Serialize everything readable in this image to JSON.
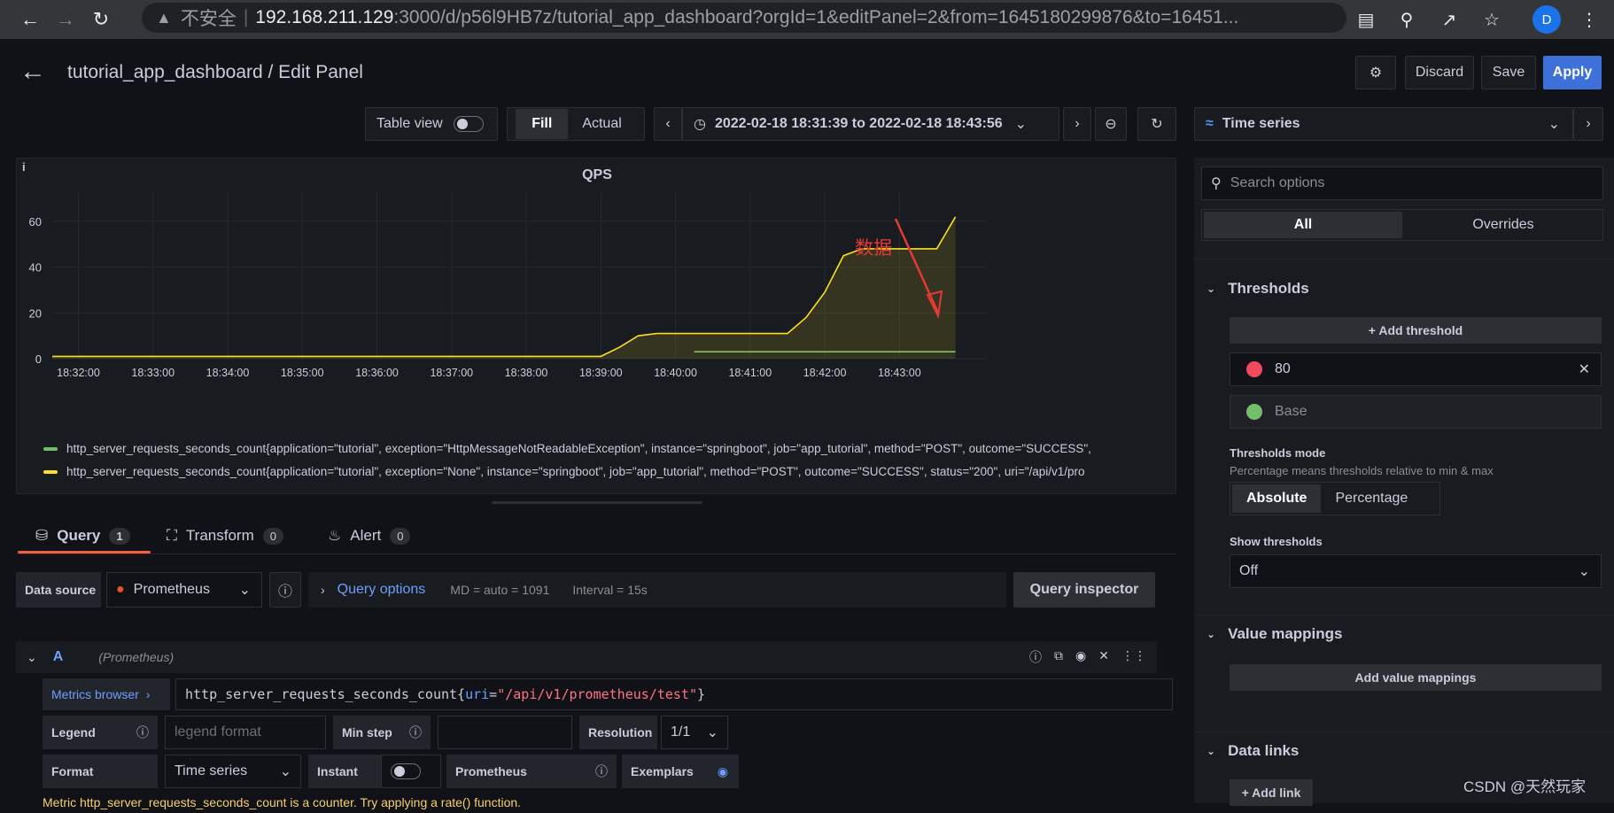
{
  "browser": {
    "security_label": "不安全",
    "url_host": "192.168.211.129",
    "url_rest": ":3000/d/p56l9HB7z/tutorial_app_dashboard?orgId=1&editPanel=2&from=1645180299876&to=16451...",
    "avatar_letter": "D"
  },
  "header": {
    "title": "tutorial_app_dashboard / Edit Panel",
    "discard_label": "Discard",
    "save_label": "Save",
    "apply_label": "Apply"
  },
  "toolbar": {
    "table_view_label": "Table view",
    "fill_label": "Fill",
    "actual_label": "Actual",
    "time_range": "2022-02-18 18:31:39 to 2022-02-18 18:43:56",
    "visualization": "Time series"
  },
  "panel": {
    "title": "QPS",
    "annotation_text": "数据",
    "legend": [
      {
        "label": "http_server_requests_seconds_count{application=\"tutorial\", exception=\"HttpMessageNotReadableException\", instance=\"springboot\", job=\"app_tutorial\", method=\"POST\", outcome=\"SUCCESS\",",
        "color": "#73bf69"
      },
      {
        "label": "http_server_requests_seconds_count{application=\"tutorial\", exception=\"None\", instance=\"springboot\", job=\"app_tutorial\", method=\"POST\", outcome=\"SUCCESS\", status=\"200\", uri=\"/api/v1/pro",
        "color": "#fade2a"
      }
    ]
  },
  "chart_data": {
    "type": "line",
    "title": "QPS",
    "x_ticks": [
      "18:32:00",
      "18:33:00",
      "18:34:00",
      "18:35:00",
      "18:36:00",
      "18:37:00",
      "18:38:00",
      "18:39:00",
      "18:40:00",
      "18:41:00",
      "18:42:00",
      "18:43:00"
    ],
    "y_ticks": [
      0,
      20,
      40,
      60
    ],
    "ylim": [
      0,
      65
    ],
    "xlim": [
      "18:31:39",
      "18:43:56"
    ],
    "series": [
      {
        "color": "#73bf69",
        "points": [
          [
            "18:40:15",
            3
          ],
          [
            "18:43:45",
            3
          ]
        ]
      },
      {
        "color": "#fade2a",
        "fill": true,
        "points": [
          [
            "18:31:39",
            1
          ],
          [
            "18:39:00",
            1
          ],
          [
            "18:39:15",
            5
          ],
          [
            "18:39:30",
            10
          ],
          [
            "18:39:45",
            11
          ],
          [
            "18:40:00",
            11
          ],
          [
            "18:41:30",
            11
          ],
          [
            "18:41:45",
            18
          ],
          [
            "18:42:00",
            29
          ],
          [
            "18:42:15",
            45
          ],
          [
            "18:42:30",
            48
          ],
          [
            "18:43:30",
            48
          ],
          [
            "18:43:45",
            62
          ]
        ]
      }
    ]
  },
  "query_tabs": [
    {
      "label": "Query",
      "count": "1"
    },
    {
      "label": "Transform",
      "count": "0"
    },
    {
      "label": "Alert",
      "count": "0"
    }
  ],
  "query": {
    "datasource_label": "Data source",
    "datasource": "Prometheus",
    "query_options_label": "Query options",
    "md": "MD = auto = 1091",
    "interval": "Interval = 15s",
    "inspector_label": "Query inspector",
    "ref_id": "A",
    "ref_source": "(Prometheus)",
    "metrics_browser": "Metrics browser",
    "expr_metric": "http_server_requests_seconds_count{",
    "expr_key": "uri",
    "expr_eq": "=",
    "expr_val": "\"/api/v1/prometheus/test\"",
    "expr_close": "}",
    "legend_label": "Legend",
    "legend_placeholder": "legend format",
    "min_step_label": "Min step",
    "resolution_label": "Resolution",
    "resolution_value": "1/1",
    "format_label": "Format",
    "format_value": "Time series",
    "instant_label": "Instant",
    "prometheus_label": "Prometheus",
    "exemplars_label": "Exemplars",
    "hint": "Metric http_server_requests_seconds_count is a counter. Try applying a rate() function."
  },
  "options": {
    "search_placeholder": "Search options",
    "tab_all": "All",
    "tab_overrides": "Overrides",
    "thresholds_title": "Thresholds",
    "add_threshold": "+ Add threshold",
    "threshold_value": "80",
    "threshold_red": "#f2495c",
    "threshold_base": "Base",
    "threshold_green": "#73bf69",
    "mode_title": "Thresholds mode",
    "mode_desc": "Percentage means thresholds relative to min & max",
    "mode_absolute": "Absolute",
    "mode_percentage": "Percentage",
    "show_thresholds_title": "Show thresholds",
    "show_thresholds_value": "Off",
    "value_mappings_title": "Value mappings",
    "add_value_mappings": "Add value mappings",
    "data_links_title": "Data links",
    "add_link": "+ Add link"
  },
  "watermark": "CSDN @天然玩家"
}
